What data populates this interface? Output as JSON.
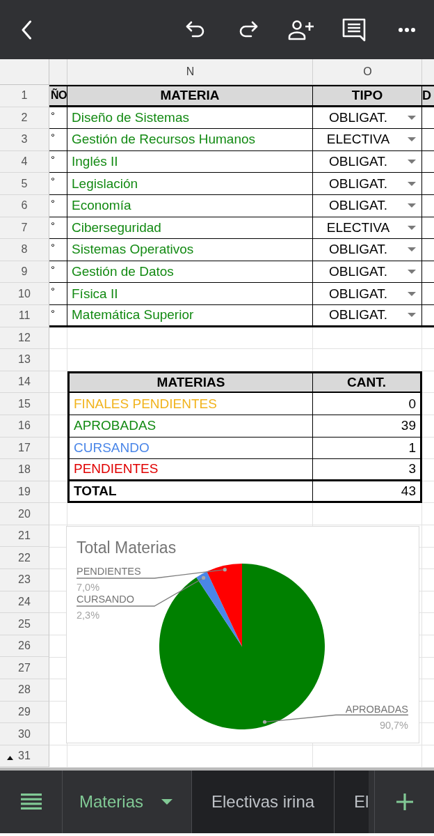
{
  "grid": {
    "column_letters": [
      "N",
      "O"
    ],
    "row_numbers": [
      "1",
      "2",
      "3",
      "4",
      "5",
      "6",
      "7",
      "8",
      "9",
      "10",
      "11",
      "12",
      "13",
      "14",
      "15",
      "16",
      "17",
      "18",
      "19",
      "20",
      "21",
      "22",
      "23",
      "24",
      "25",
      "26",
      "27",
      "28",
      "29",
      "30",
      "31"
    ]
  },
  "subjects_table": {
    "header": {
      "column_1": "ÑO",
      "materia": "MATERIA",
      "tipo": "TIPO",
      "column_4": "D"
    },
    "rows": [
      {
        "column_1": "°",
        "materia": "Diseño de Sistemas",
        "tipo": "OBLIGAT."
      },
      {
        "column_1": "°",
        "materia": "Gestión de Recursos Humanos",
        "tipo": "ELECTIVA"
      },
      {
        "column_1": "°",
        "materia": "Inglés II",
        "tipo": "OBLIGAT."
      },
      {
        "column_1": "°",
        "materia": "Legislación",
        "tipo": "OBLIGAT."
      },
      {
        "column_1": "°",
        "materia": "Economía",
        "tipo": "OBLIGAT."
      },
      {
        "column_1": "°",
        "materia": "Ciberseguridad",
        "tipo": "ELECTIVA"
      },
      {
        "column_1": "°",
        "materia": "Sistemas Operativos",
        "tipo": "OBLIGAT."
      },
      {
        "column_1": "°",
        "materia": "Gestión de Datos",
        "tipo": "OBLIGAT."
      },
      {
        "column_1": "°",
        "materia": "Física II",
        "tipo": "OBLIGAT."
      },
      {
        "column_1": "°",
        "materia": "Matemática Superior",
        "tipo": "OBLIGAT."
      }
    ]
  },
  "summary_table": {
    "columns": [
      "MATERIAS",
      "CANT."
    ],
    "rows": [
      {
        "label": "FINALES PENDIENTES",
        "count": "0",
        "color": "#f1b31c"
      },
      {
        "label": "APROBADAS",
        "count": "39",
        "color": "#138a13"
      },
      {
        "label": "CURSANDO",
        "count": "1",
        "color": "#4a86e8"
      },
      {
        "label": "PENDIENTES",
        "count": "3",
        "color": "#e00000"
      }
    ],
    "total": {
      "label": "TOTAL",
      "count": "43"
    }
  },
  "chart": {
    "chart_data": {
      "type": "pie",
      "title": "Total Materias",
      "categories": [
        "APROBADAS",
        "CURSANDO",
        "PENDIENTES"
      ],
      "values": [
        90.7,
        2.3,
        7.0
      ],
      "colors": [
        "#008000",
        "#4a86e8",
        "#ff0000"
      ],
      "data_labels": true,
      "value_labels": [
        "90,7%",
        "2,3%",
        "7,0%"
      ]
    }
  },
  "sheet_tabs": [
    {
      "label": "Materias",
      "selected": true
    },
    {
      "label": "Electivas irina",
      "selected": false
    },
    {
      "label": "El",
      "selected": false
    }
  ]
}
